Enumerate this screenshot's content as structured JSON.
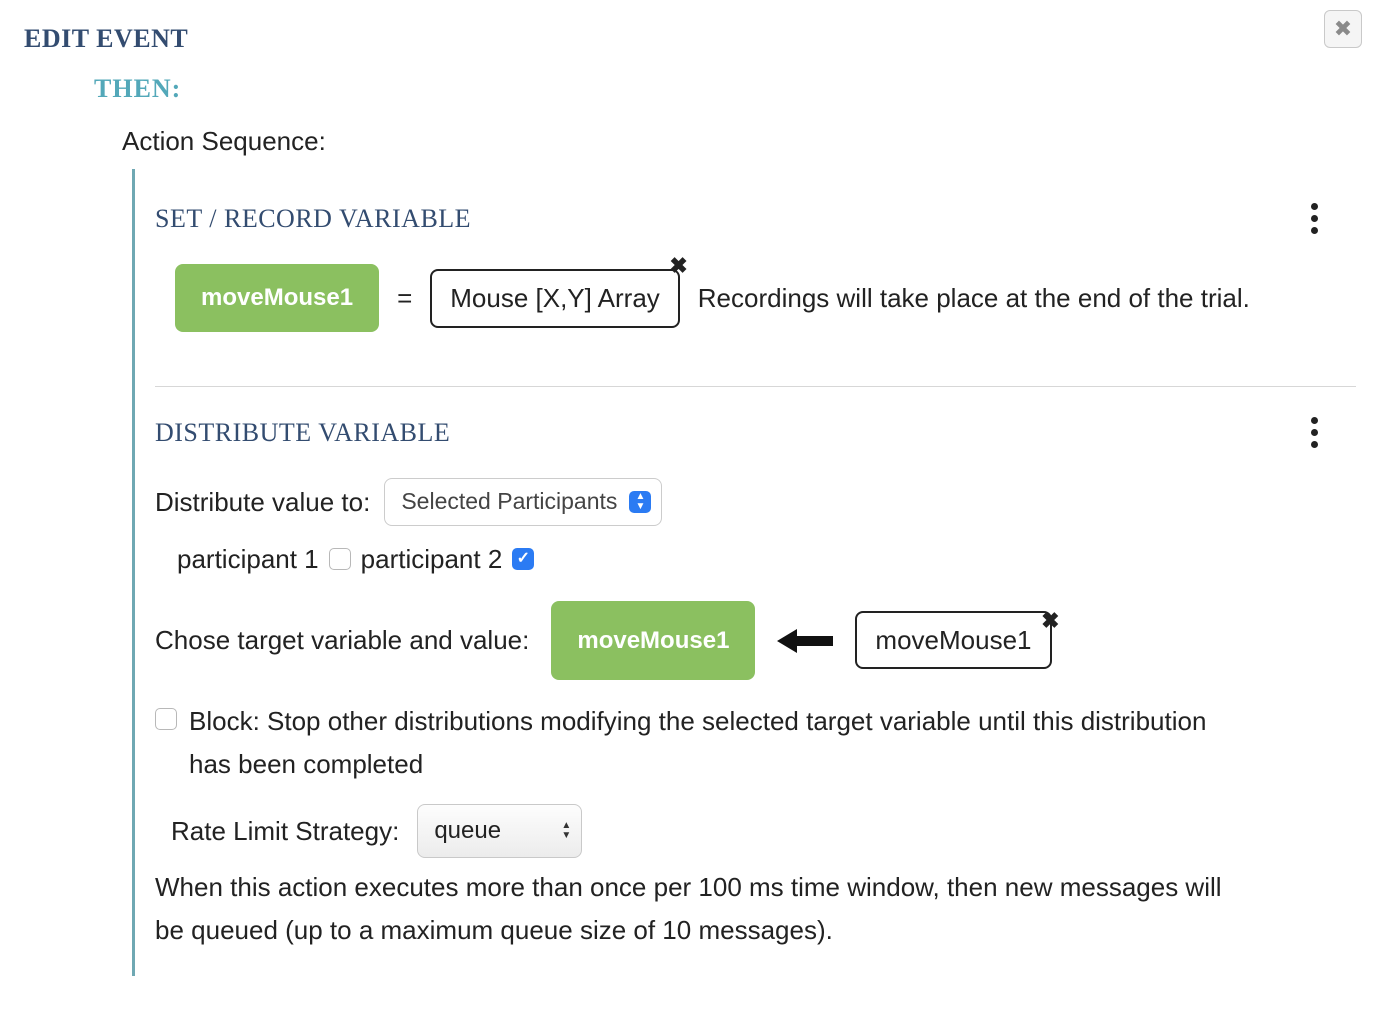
{
  "dialog": {
    "title": "EDIT EVENT",
    "close_icon": "✖"
  },
  "then": {
    "label": "THEN:",
    "sequence_label": "Action Sequence:"
  },
  "set_record": {
    "title": "SET / RECORD VARIABLE",
    "variable_chip": "moveMouse1",
    "equals": "=",
    "value_chip": "Mouse [X,Y] Array",
    "description": "Recordings will take place at the end of the trial."
  },
  "distribute": {
    "title": "DISTRIBUTE VARIABLE",
    "distribute_to_label": "Distribute value to:",
    "distribute_to_value": "Selected Participants",
    "participants": [
      {
        "label": "participant 1",
        "checked": false
      },
      {
        "label": "participant 2",
        "checked": true
      }
    ],
    "target_label": "Chose target variable and value:",
    "target_variable_chip": "moveMouse1",
    "source_value_chip": "moveMouse1",
    "block": {
      "checked": false,
      "text": "Block: Stop other distributions modifying the selected target variable until this distribution has been completed"
    },
    "rate_limit": {
      "label": "Rate Limit Strategy:",
      "value": "queue",
      "description": "When this action executes more than once per 100 ms time window, then new messages will be queued (up to a maximum queue size of 10 messages)."
    }
  }
}
